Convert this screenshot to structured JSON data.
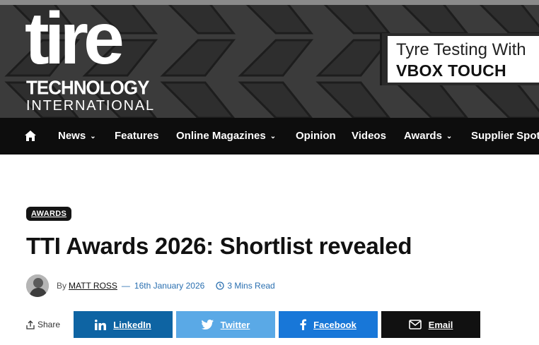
{
  "header": {
    "logo": {
      "line1": "tire",
      "line2": "TECHNOLOGY",
      "line3": "INTERNATIONAL"
    },
    "ad": {
      "line1": "Tyre Testing With",
      "line2": "VBOX TOUCH"
    }
  },
  "nav": {
    "home_icon": "home-icon",
    "items": [
      {
        "label": "News",
        "has_dropdown": true
      },
      {
        "label": "Features",
        "has_dropdown": false
      },
      {
        "label": "Online Magazines",
        "has_dropdown": true
      },
      {
        "label": "Opinion",
        "has_dropdown": false
      },
      {
        "label": "Videos",
        "has_dropdown": false
      },
      {
        "label": "Awards",
        "has_dropdown": true
      },
      {
        "label": "Supplier Spot",
        "has_dropdown": false
      }
    ]
  },
  "article": {
    "category": "AWARDS",
    "title": "TTI Awards 2026: Shortlist revealed",
    "by_label": "By",
    "author": "MATT ROSS",
    "separator": "—",
    "date": "16th January 2026",
    "read_time": "3 Mins Read"
  },
  "share": {
    "label": "Share",
    "buttons": [
      {
        "label": "LinkedIn",
        "icon": "linkedin-icon",
        "color": "#0e64a3"
      },
      {
        "label": "Twitter",
        "icon": "twitter-icon",
        "color": "#5aa9e6"
      },
      {
        "label": "Facebook",
        "icon": "facebook-icon",
        "color": "#1877d8"
      },
      {
        "label": "Email",
        "icon": "email-icon",
        "color": "#111111"
      }
    ]
  },
  "colors": {
    "nav_bg": "#0d0d0d",
    "accent_blue": "#2a6fb0",
    "header_bg": "#3c3c3c"
  }
}
